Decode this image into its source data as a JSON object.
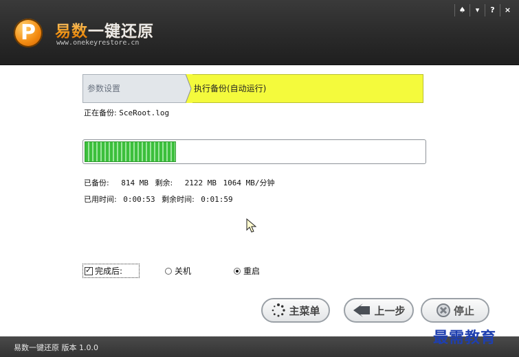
{
  "header": {
    "logo_letter": "P",
    "title_first": "易数",
    "title_rest": "一键还原",
    "url": "www.onekeyrestore.cn",
    "window_controls": [
      "♠",
      "▾",
      "?",
      "×"
    ]
  },
  "steps": {
    "step1_label": "参数设置",
    "step2_label": "执行备份(自动运行)"
  },
  "current": {
    "label": "正在备份:",
    "file": "SceRoot.log"
  },
  "progress": {
    "fraction": 0.27
  },
  "stats": {
    "backed_label": "已备份:",
    "backed_value": "814 MB",
    "remaining_label": "剩余:",
    "remaining_value": "2122 MB",
    "speed_value": "1064 MB/分钟",
    "elapsed_label": "已用时间:",
    "elapsed_value": "0:00:53",
    "remain_time_label": "剩余时间:",
    "remain_time_value": "0:01:59"
  },
  "options": {
    "after_label": "完成后:",
    "shutdown_label": "关机",
    "restart_label": "重启",
    "selected": "restart"
  },
  "buttons": {
    "main_menu": "主菜单",
    "previous": "上一步",
    "stop": "停止"
  },
  "footer": {
    "version_text": "易数一键还原 版本 1.0.0"
  },
  "watermark": "最需教育",
  "colors": {
    "active_step": "#f4fa3c",
    "progress_green": "#3cbf3c",
    "header_bg": "#2a2a2a"
  }
}
